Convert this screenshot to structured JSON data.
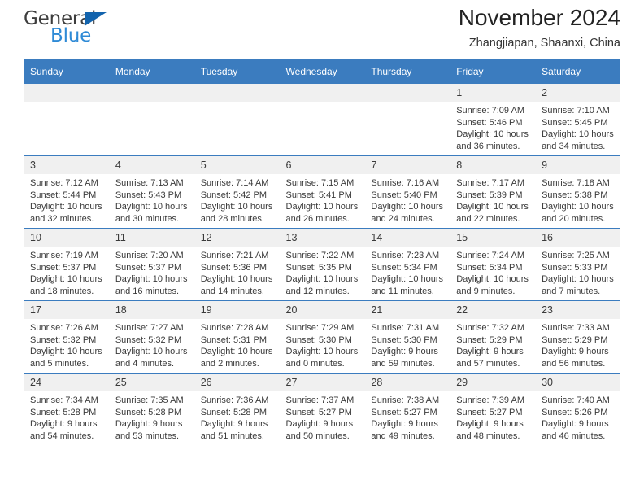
{
  "brand": {
    "name_top": "General",
    "name_bottom": "Blue",
    "accent_color": "#2e8ad6",
    "triangle_color": "#1263ad"
  },
  "header": {
    "title": "November 2024",
    "subtitle": "Zhangjiapan, Shaanxi, China"
  },
  "theme": {
    "header_row_bg": "#3b7cbf",
    "daynum_bg": "#f0f0f0",
    "text": "#3a3a3a"
  },
  "weekday_headers": [
    "Sunday",
    "Monday",
    "Tuesday",
    "Wednesday",
    "Thursday",
    "Friday",
    "Saturday"
  ],
  "weeks": [
    [
      {
        "day": "",
        "lines": []
      },
      {
        "day": "",
        "lines": []
      },
      {
        "day": "",
        "lines": []
      },
      {
        "day": "",
        "lines": []
      },
      {
        "day": "",
        "lines": []
      },
      {
        "day": "1",
        "lines": [
          "Sunrise: 7:09 AM",
          "Sunset: 5:46 PM",
          "Daylight: 10 hours",
          "and 36 minutes."
        ]
      },
      {
        "day": "2",
        "lines": [
          "Sunrise: 7:10 AM",
          "Sunset: 5:45 PM",
          "Daylight: 10 hours",
          "and 34 minutes."
        ]
      }
    ],
    [
      {
        "day": "3",
        "lines": [
          "Sunrise: 7:12 AM",
          "Sunset: 5:44 PM",
          "Daylight: 10 hours",
          "and 32 minutes."
        ]
      },
      {
        "day": "4",
        "lines": [
          "Sunrise: 7:13 AM",
          "Sunset: 5:43 PM",
          "Daylight: 10 hours",
          "and 30 minutes."
        ]
      },
      {
        "day": "5",
        "lines": [
          "Sunrise: 7:14 AM",
          "Sunset: 5:42 PM",
          "Daylight: 10 hours",
          "and 28 minutes."
        ]
      },
      {
        "day": "6",
        "lines": [
          "Sunrise: 7:15 AM",
          "Sunset: 5:41 PM",
          "Daylight: 10 hours",
          "and 26 minutes."
        ]
      },
      {
        "day": "7",
        "lines": [
          "Sunrise: 7:16 AM",
          "Sunset: 5:40 PM",
          "Daylight: 10 hours",
          "and 24 minutes."
        ]
      },
      {
        "day": "8",
        "lines": [
          "Sunrise: 7:17 AM",
          "Sunset: 5:39 PM",
          "Daylight: 10 hours",
          "and 22 minutes."
        ]
      },
      {
        "day": "9",
        "lines": [
          "Sunrise: 7:18 AM",
          "Sunset: 5:38 PM",
          "Daylight: 10 hours",
          "and 20 minutes."
        ]
      }
    ],
    [
      {
        "day": "10",
        "lines": [
          "Sunrise: 7:19 AM",
          "Sunset: 5:37 PM",
          "Daylight: 10 hours",
          "and 18 minutes."
        ]
      },
      {
        "day": "11",
        "lines": [
          "Sunrise: 7:20 AM",
          "Sunset: 5:37 PM",
          "Daylight: 10 hours",
          "and 16 minutes."
        ]
      },
      {
        "day": "12",
        "lines": [
          "Sunrise: 7:21 AM",
          "Sunset: 5:36 PM",
          "Daylight: 10 hours",
          "and 14 minutes."
        ]
      },
      {
        "day": "13",
        "lines": [
          "Sunrise: 7:22 AM",
          "Sunset: 5:35 PM",
          "Daylight: 10 hours",
          "and 12 minutes."
        ]
      },
      {
        "day": "14",
        "lines": [
          "Sunrise: 7:23 AM",
          "Sunset: 5:34 PM",
          "Daylight: 10 hours",
          "and 11 minutes."
        ]
      },
      {
        "day": "15",
        "lines": [
          "Sunrise: 7:24 AM",
          "Sunset: 5:34 PM",
          "Daylight: 10 hours",
          "and 9 minutes."
        ]
      },
      {
        "day": "16",
        "lines": [
          "Sunrise: 7:25 AM",
          "Sunset: 5:33 PM",
          "Daylight: 10 hours",
          "and 7 minutes."
        ]
      }
    ],
    [
      {
        "day": "17",
        "lines": [
          "Sunrise: 7:26 AM",
          "Sunset: 5:32 PM",
          "Daylight: 10 hours",
          "and 5 minutes."
        ]
      },
      {
        "day": "18",
        "lines": [
          "Sunrise: 7:27 AM",
          "Sunset: 5:32 PM",
          "Daylight: 10 hours",
          "and 4 minutes."
        ]
      },
      {
        "day": "19",
        "lines": [
          "Sunrise: 7:28 AM",
          "Sunset: 5:31 PM",
          "Daylight: 10 hours",
          "and 2 minutes."
        ]
      },
      {
        "day": "20",
        "lines": [
          "Sunrise: 7:29 AM",
          "Sunset: 5:30 PM",
          "Daylight: 10 hours",
          "and 0 minutes."
        ]
      },
      {
        "day": "21",
        "lines": [
          "Sunrise: 7:31 AM",
          "Sunset: 5:30 PM",
          "Daylight: 9 hours",
          "and 59 minutes."
        ]
      },
      {
        "day": "22",
        "lines": [
          "Sunrise: 7:32 AM",
          "Sunset: 5:29 PM",
          "Daylight: 9 hours",
          "and 57 minutes."
        ]
      },
      {
        "day": "23",
        "lines": [
          "Sunrise: 7:33 AM",
          "Sunset: 5:29 PM",
          "Daylight: 9 hours",
          "and 56 minutes."
        ]
      }
    ],
    [
      {
        "day": "24",
        "lines": [
          "Sunrise: 7:34 AM",
          "Sunset: 5:28 PM",
          "Daylight: 9 hours",
          "and 54 minutes."
        ]
      },
      {
        "day": "25",
        "lines": [
          "Sunrise: 7:35 AM",
          "Sunset: 5:28 PM",
          "Daylight: 9 hours",
          "and 53 minutes."
        ]
      },
      {
        "day": "26",
        "lines": [
          "Sunrise: 7:36 AM",
          "Sunset: 5:28 PM",
          "Daylight: 9 hours",
          "and 51 minutes."
        ]
      },
      {
        "day": "27",
        "lines": [
          "Sunrise: 7:37 AM",
          "Sunset: 5:27 PM",
          "Daylight: 9 hours",
          "and 50 minutes."
        ]
      },
      {
        "day": "28",
        "lines": [
          "Sunrise: 7:38 AM",
          "Sunset: 5:27 PM",
          "Daylight: 9 hours",
          "and 49 minutes."
        ]
      },
      {
        "day": "29",
        "lines": [
          "Sunrise: 7:39 AM",
          "Sunset: 5:27 PM",
          "Daylight: 9 hours",
          "and 48 minutes."
        ]
      },
      {
        "day": "30",
        "lines": [
          "Sunrise: 7:40 AM",
          "Sunset: 5:26 PM",
          "Daylight: 9 hours",
          "and 46 minutes."
        ]
      }
    ]
  ]
}
